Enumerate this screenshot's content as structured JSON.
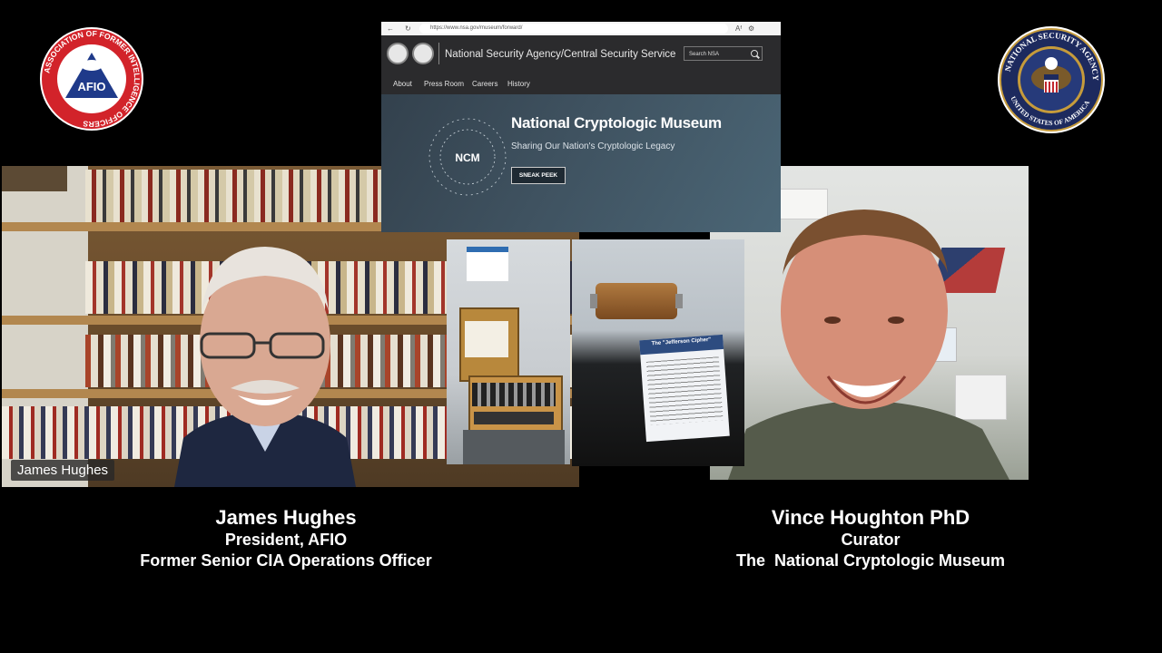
{
  "logos": {
    "afio_text": "ASSOCIATION OF FORMER INTELLIGENCE OFFICERS",
    "afio_abbrev": "AFIO",
    "nsa_text_top": "NATIONAL SECURITY AGENCY",
    "nsa_text_bottom": "UNITED STATES OF AMERICA"
  },
  "left_video": {
    "name_tag": "James Hughes"
  },
  "browser": {
    "url": "https://www.nsa.gov/museum/forward/",
    "site_title": "National Security Agency/Central Security Service",
    "search_placeholder": "Search NSA",
    "nav": [
      "About",
      "Press Room",
      "Careers",
      "History"
    ],
    "hero_title": "National Cryptologic Museum",
    "hero_subtitle": "Sharing Our Nation's Cryptologic Legacy",
    "hero_button": "SNEAK PEEK",
    "ncm_letters": "NCM"
  },
  "photo2": {
    "placard_title": "The \"Jefferson Cipher\""
  },
  "captions": {
    "left": {
      "name": "James Hughes",
      "role": "President, AFIO",
      "title": "Former Senior CIA Operations Officer"
    },
    "right": {
      "name": "Vince Houghton PhD",
      "role": "Curator",
      "title": "The  National Cryptologic Museum"
    }
  }
}
